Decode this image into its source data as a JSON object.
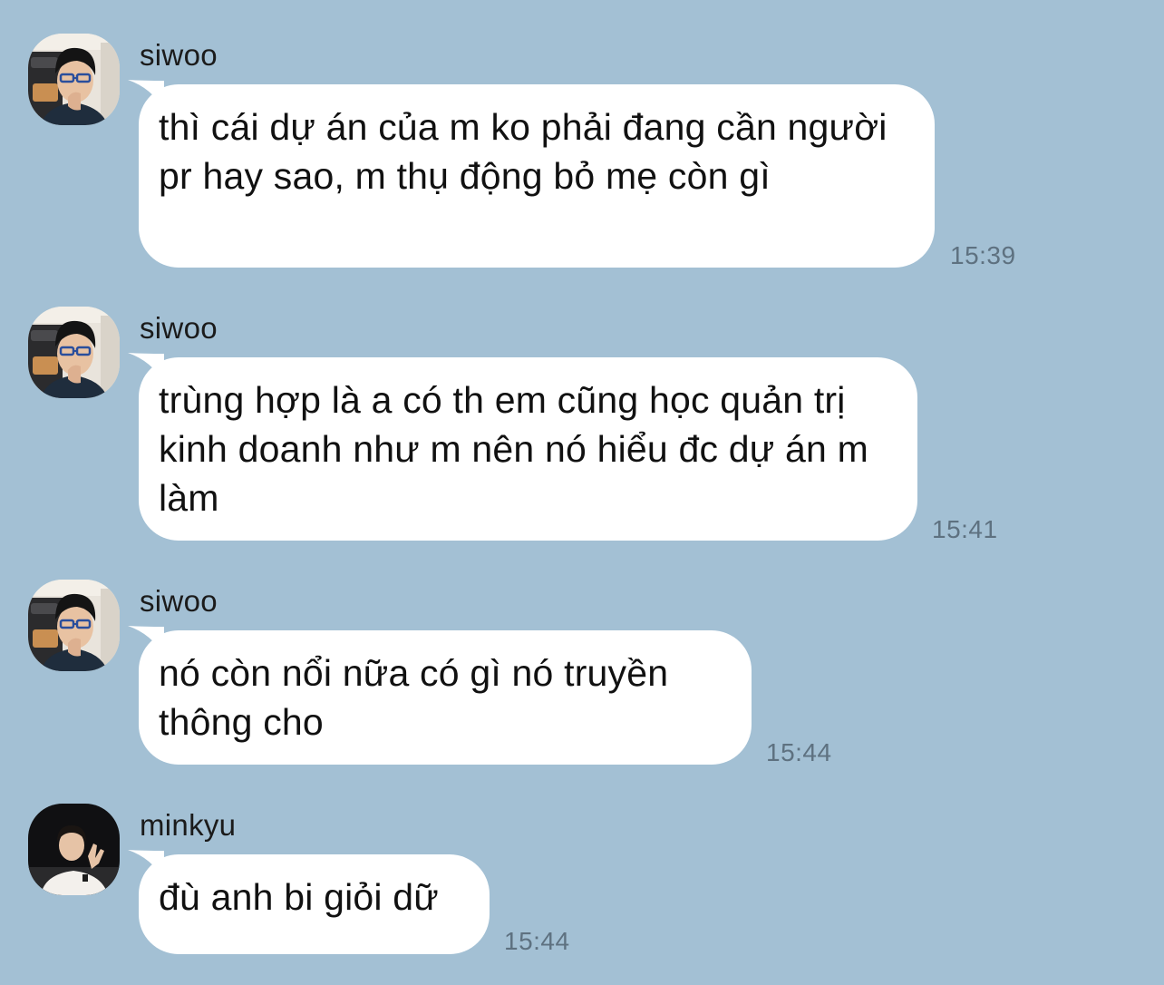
{
  "chat": {
    "messages": [
      {
        "sender": "siwoo",
        "avatar_icon": "user-avatar-siwoo",
        "text": "thì cái dự án của m ko phải đang cần người pr hay sao, m thụ động bỏ mẹ còn gì",
        "time": "15:39"
      },
      {
        "sender": "siwoo",
        "avatar_icon": "user-avatar-siwoo",
        "text": "trùng hợp là a có th em cũng học quản trị kinh doanh như m nên nó hiểu đc dự án m làm",
        "time": "15:41"
      },
      {
        "sender": "siwoo",
        "avatar_icon": "user-avatar-siwoo",
        "text": "nó còn nổi nữa có gì nó truyền thông cho",
        "time": "15:44"
      },
      {
        "sender": "minkyu",
        "avatar_icon": "user-avatar-minkyu",
        "text": "đù anh bi giỏi dữ",
        "time": "15:44"
      }
    ]
  },
  "colors": {
    "background": "#a3c0d4",
    "bubble": "#ffffff",
    "timestamp": "#5e7180",
    "sender_name": "#1b1b1b"
  }
}
